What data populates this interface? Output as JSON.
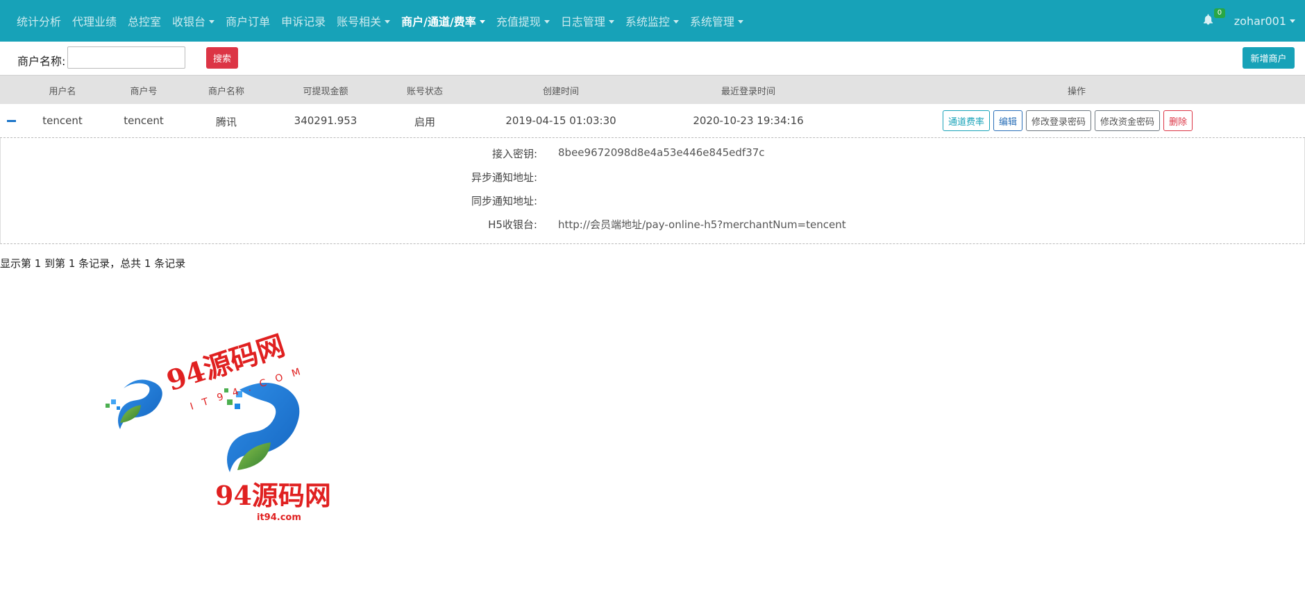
{
  "nav": {
    "items": [
      {
        "label": "统计分析",
        "dropdown": false,
        "active": false
      },
      {
        "label": "代理业绩",
        "dropdown": false,
        "active": false
      },
      {
        "label": "总控室",
        "dropdown": false,
        "active": false
      },
      {
        "label": "收银台",
        "dropdown": true,
        "active": false
      },
      {
        "label": "商户订单",
        "dropdown": false,
        "active": false
      },
      {
        "label": "申诉记录",
        "dropdown": false,
        "active": false
      },
      {
        "label": "账号相关",
        "dropdown": true,
        "active": false
      },
      {
        "label": "商户/通道/费率",
        "dropdown": true,
        "active": true
      },
      {
        "label": "充值提现",
        "dropdown": true,
        "active": false
      },
      {
        "label": "日志管理",
        "dropdown": true,
        "active": false
      },
      {
        "label": "系统监控",
        "dropdown": true,
        "active": false
      },
      {
        "label": "系统管理",
        "dropdown": true,
        "active": false
      }
    ],
    "notification_count": "0",
    "user": "zohar001"
  },
  "toolbar": {
    "search_label": "商户名称:",
    "search_value": "",
    "search_button": "搜索",
    "add_button": "新增商户"
  },
  "table": {
    "headers": [
      "用户名",
      "商户号",
      "商户名称",
      "可提现金额",
      "账号状态",
      "创建时间",
      "最近登录时间",
      "操作"
    ],
    "rows": [
      {
        "username": "tencent",
        "merchant_no": "tencent",
        "merchant_name": "腾讯",
        "withdrawable": "340291.953",
        "status": "启用",
        "created": "2019-04-15 01:03:30",
        "last_login": "2020-10-23 19:34:16",
        "actions": [
          "通道费率",
          "编辑",
          "修改登录密码",
          "修改资金密码",
          "删除"
        ],
        "detail": [
          {
            "label": "接入密钥:",
            "value": "8bee9672098d8e4a53e446e845edf37c"
          },
          {
            "label": "异步通知地址:",
            "value": ""
          },
          {
            "label": "同步通知地址:",
            "value": ""
          },
          {
            "label": "H5收银台:",
            "value": "http://会员端地址/pay-online-h5?merchantNum=tencent"
          }
        ]
      }
    ]
  },
  "pagination": "显示第 1 到第 1 条记录，总共 1 条记录",
  "watermark": {
    "text_main": "94源码网",
    "text_arc": "IT94.COM",
    "text_small": "it94.com"
  },
  "colors": {
    "navbar": "#17a2b8",
    "danger": "#dc3545",
    "header_bg": "#e2e2e2"
  }
}
